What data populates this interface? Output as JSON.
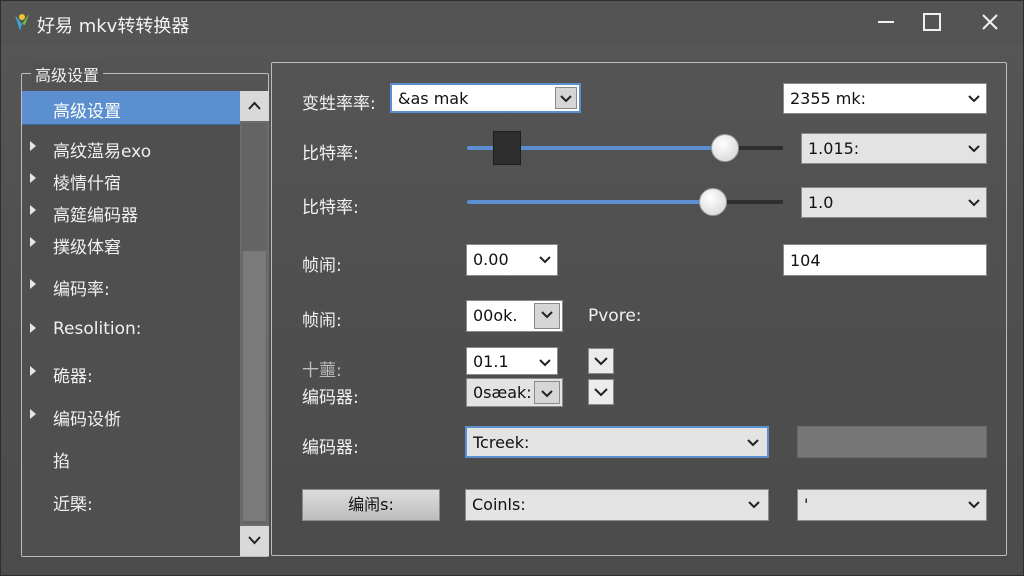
{
  "window": {
    "title": "好易 mkv转转换器",
    "colors": {
      "accent": "#5b8fd0",
      "background": "#4f4f4f"
    }
  },
  "sidebar": {
    "group_title": "高级设置",
    "header": "高级设置",
    "items": [
      {
        "label": "高纹蕰易exo",
        "expandable": true
      },
      {
        "label": "棱情什宿",
        "expandable": true
      },
      {
        "label": "高筵编码器",
        "expandable": true
      },
      {
        "label": "撲级体窘",
        "expandable": true
      },
      {
        "label": "编码率:",
        "expandable": true
      },
      {
        "label": "Resolition:",
        "expandable": true
      },
      {
        "label": "硊器:",
        "expandable": true
      },
      {
        "label": "编码设㑜",
        "expandable": true
      },
      {
        "label": "掐",
        "expandable": false
      },
      {
        "label": "近槩:",
        "expandable": false
      }
    ]
  },
  "form": {
    "row1": {
      "label": "变甡率率:",
      "combo_value": "&as mak",
      "combo2_value": "2355 mk:"
    },
    "row2": {
      "label": "比特率:",
      "slider_level_percent": 82,
      "combo_value": "1.015:"
    },
    "row3": {
      "label": "比特率:",
      "slider_level_percent": 78,
      "combo_value": "1.0"
    },
    "row4": {
      "label": "帧闹:",
      "combo_value": "0.00",
      "text_value": "104"
    },
    "row5": {
      "label": "帧闹:",
      "combo_value": "00ok.",
      "side_label": "Pvore:"
    },
    "row6": {
      "label": "十蘁:",
      "combo_value": "01.1"
    },
    "row7": {
      "label": "编码器:",
      "combo_value": "0sæak:"
    },
    "row8": {
      "label": "编码器:",
      "combo_value": "Tcreek:"
    },
    "row9": {
      "button_label": "编闹s:",
      "combo_value": "Coinls:",
      "combo2_value": "'"
    }
  },
  "icons": {
    "app": "app-logo-icon",
    "minimize": "minimize-icon",
    "maximize": "maximize-icon",
    "close": "close-icon",
    "dropdown": "chevron-down-icon",
    "scroll_up": "chevron-up-icon"
  }
}
